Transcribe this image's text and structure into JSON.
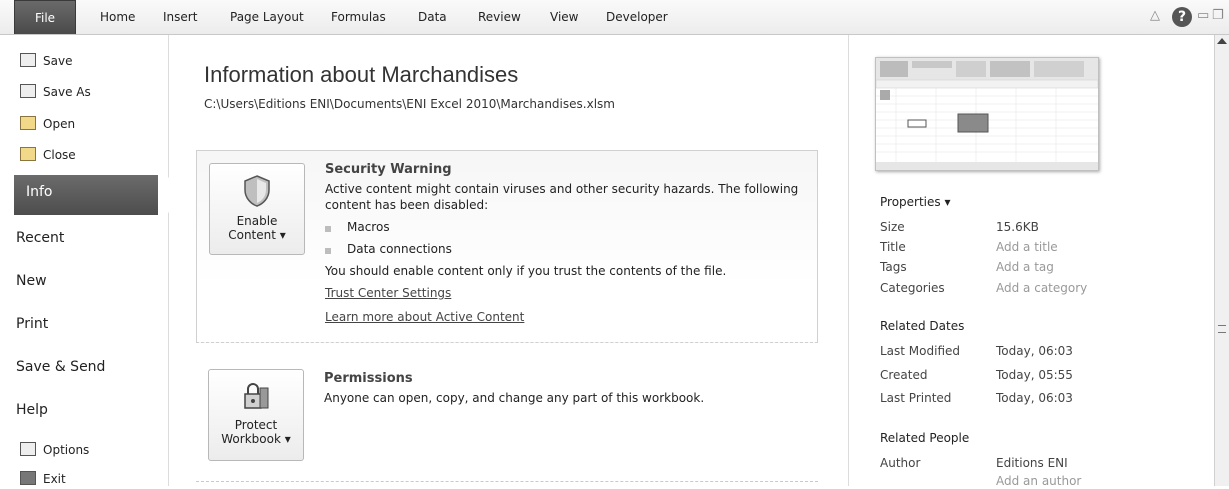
{
  "ribbon": {
    "tabs": [
      "File",
      "Home",
      "Insert",
      "Page Layout",
      "Formulas",
      "Data",
      "Review",
      "View",
      "Developer"
    ]
  },
  "backstage": {
    "commands": [
      {
        "label": "Save",
        "icon": "save-icon"
      },
      {
        "label": "Save As",
        "icon": "save-as-icon"
      },
      {
        "label": "Open",
        "icon": "open-folder-icon"
      },
      {
        "label": "Close",
        "icon": "close-folder-icon"
      }
    ],
    "selected": "Info",
    "sections": [
      "Recent",
      "New",
      "Print",
      "Save & Send",
      "Help"
    ],
    "options_label": "Options",
    "exit_label": "Exit"
  },
  "main": {
    "title": "Information about Marchandises",
    "path": "C:\\Users\\Editions ENI\\Documents\\ENI Excel 2010\\Marchandises.xlsm",
    "security": {
      "button_line1": "Enable",
      "button_line2": "Content ▾",
      "heading": "Security Warning",
      "text1": "Active content might contain viruses and other security hazards. The following",
      "text2": "content has been disabled:",
      "bullets": [
        "Macros",
        "Data connections"
      ],
      "advice": "You should enable content only if you trust the contents of the file.",
      "link1": "Trust Center Settings",
      "link2": "Learn more about Active Content"
    },
    "permissions": {
      "button_line1": "Protect",
      "button_line2": "Workbook ▾",
      "heading": "Permissions",
      "text": "Anyone can open, copy, and change any part of this workbook."
    }
  },
  "properties": {
    "heading": "Properties ▾",
    "rows": [
      {
        "key": "Size",
        "value": "15.6KB"
      },
      {
        "key": "Title",
        "value": "Add a title"
      },
      {
        "key": "Tags",
        "value": "Add a tag"
      },
      {
        "key": "Categories",
        "value": "Add a category"
      }
    ],
    "dates_heading": "Related Dates",
    "dates": [
      {
        "key": "Last Modified",
        "value": "Today, 06:03"
      },
      {
        "key": "Created",
        "value": "Today, 05:55"
      },
      {
        "key": "Last Printed",
        "value": "Today, 06:03"
      }
    ],
    "people_heading": "Related People",
    "author_key": "Author",
    "author_value": "Editions ENI",
    "add_author": "Add an author"
  },
  "colors": {
    "selected_bg": "#555555",
    "file_tab": "#555555"
  }
}
